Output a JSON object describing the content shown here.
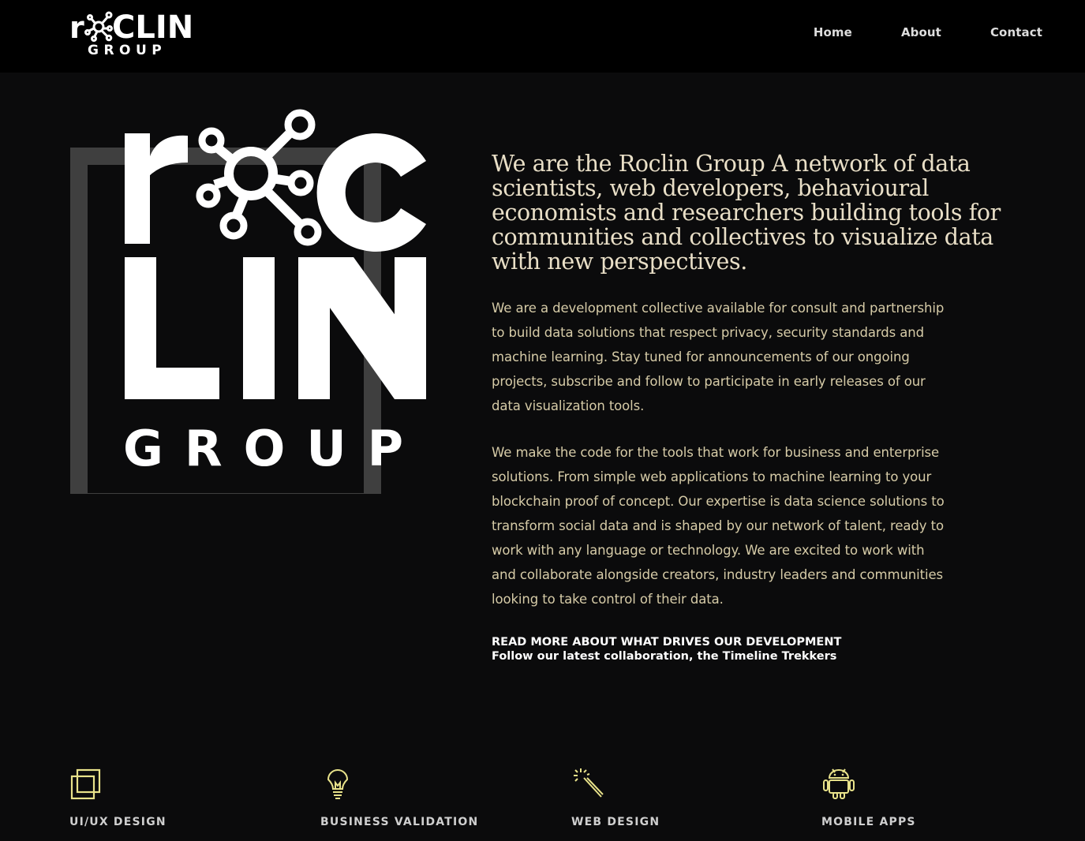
{
  "brand": {
    "name": "Roclin Group",
    "logo_top": "rCLIN",
    "logo_bottom": "GROUP"
  },
  "nav": {
    "items": [
      "Home",
      "About",
      "Contact"
    ]
  },
  "hero": {
    "logo_word1": "r",
    "logo_word2": "C",
    "logo_word3": "LIN",
    "logo_word4": "GROUP",
    "headline": "We are the Roclin Group A network of data scientists, web developers, behavioural economists and researchers building tools for communities and collectives to visualize data with new perspectives.",
    "paragraph1": "We are a development collective available for consult and partnership to build data solutions that respect privacy, security standards and machine learning. Stay tuned for announcements of our ongoing projects, subscribe and follow to participate in early releases of our data visualization tools.",
    "paragraph2": "We make the code for the tools that work for business and enterprise solutions. From simple web applications to machine learning to your blockchain proof of concept. Our expertise is data science solutions to transform social data and is shaped by our network of talent, ready to work with any language or technology. We are excited to work with and collaborate alongside creators, industry leaders and communities looking to take control of their data.",
    "link1": "READ MORE ABOUT WHAT DRIVES OUR DEVELOPMENT",
    "link2": "Follow our latest collaboration, the Timeline Trekkers"
  },
  "services": [
    {
      "label": "UI/UX DESIGN",
      "icon": "layers-icon"
    },
    {
      "label": "BUSINESS VALIDATION",
      "icon": "lightbulb-icon"
    },
    {
      "label": "WEB DESIGN",
      "icon": "magic-wand-icon"
    },
    {
      "label": "MOBILE APPS",
      "icon": "android-icon"
    }
  ],
  "colors": {
    "accent": "#e8e28a",
    "text": "#d6cba7",
    "headline": "#e9dfc7",
    "background": "#0b0b0c"
  }
}
